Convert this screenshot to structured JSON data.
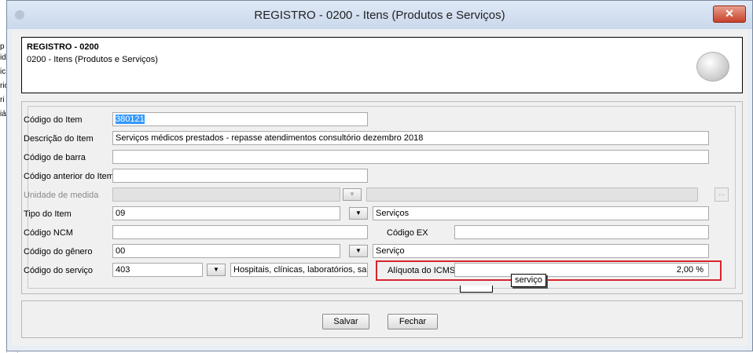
{
  "background_app": {
    "letters": [
      "p",
      "id",
      "ic",
      "rio",
      "ri",
      "iá"
    ]
  },
  "window": {
    "title": "REGISTRO - 0200 - Itens (Produtos e Serviços)",
    "close_glyph": "✕"
  },
  "header": {
    "title": "REGISTRO - 0200",
    "subtitle": "0200 - Itens (Produtos e Serviços)"
  },
  "fields": {
    "codigo_item": {
      "label": "Código do Item",
      "value": "380121"
    },
    "descricao_item": {
      "label": "Descrição do Item",
      "value": "Serviços médicos prestados - repasse atendimentos consultório dezembro 2018"
    },
    "codigo_barra": {
      "label": "Código de barra",
      "value": ""
    },
    "codigo_anterior": {
      "label": "Código anterior do Item",
      "value": ""
    },
    "unidade_medida": {
      "label": "Unidade de medida",
      "value": "",
      "description": "",
      "ellipsis": "..."
    },
    "tipo_item": {
      "label": "Tipo do Item",
      "value": "09",
      "description": "Serviços"
    },
    "codigo_ncm": {
      "label": "Código NCM",
      "value": ""
    },
    "codigo_ex": {
      "label": "Código EX",
      "value": ""
    },
    "codigo_genero": {
      "label": "Código do gênero",
      "value": "00",
      "description": "Serviço"
    },
    "codigo_servico": {
      "label": "Código do serviço",
      "value": "403",
      "description": "Hospitais, clínicas, laboratórios, sa"
    },
    "aliquota_icms": {
      "label": "Alíquota do ICMS",
      "value": "2,00 %"
    }
  },
  "tooltip": {
    "text": "serviço"
  },
  "buttons": {
    "save": "Salvar",
    "close": "Fechar"
  },
  "colors": {
    "highlight": "#d9232b",
    "selection": "#3399ff"
  },
  "icons": {
    "dropdown": "▼"
  }
}
